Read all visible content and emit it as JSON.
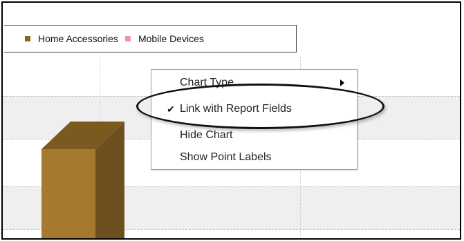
{
  "legend": {
    "items": [
      {
        "label": "Home Accessories",
        "color": "#8b6418"
      },
      {
        "label": "Mobile Devices",
        "color": "#f48fc0"
      }
    ]
  },
  "chart": {
    "bar_color_front": "#a67a2e",
    "bar_color_top": "#7a5a1e",
    "bar_color_side": "#6e5020"
  },
  "context_menu": {
    "items": [
      {
        "label": "Chart Type",
        "checked": false,
        "has_submenu": true
      },
      {
        "label": "Link with Report Fields",
        "checked": true,
        "has_submenu": false
      },
      {
        "label": "Hide Chart",
        "checked": false,
        "has_submenu": false
      },
      {
        "label": "Show Point Labels",
        "checked": false,
        "has_submenu": false
      }
    ],
    "check_glyph": "✔"
  }
}
